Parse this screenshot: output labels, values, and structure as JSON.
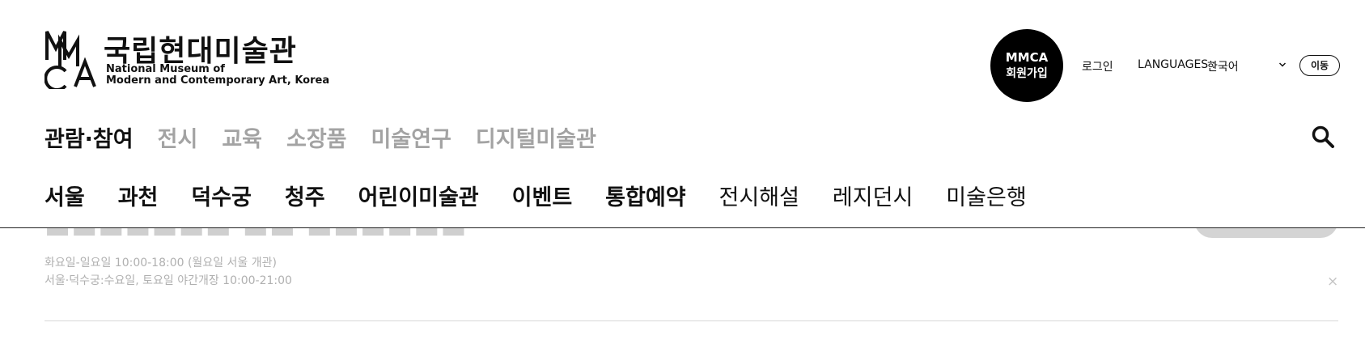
{
  "brand": {
    "name_kr": "국립현대미술관",
    "name_en_line1": "National Museum of",
    "name_en_line2": "Modern and Contemporary Art, Korea",
    "logo_icon": "mmca-logo-icon"
  },
  "utility": {
    "join_line1": "MMCA",
    "join_line2": "회원가입",
    "login": "로그인",
    "languages_label": "LANGUAGES :",
    "language_value": "한국어",
    "go_button": "이동"
  },
  "main_nav": [
    {
      "label": "관람·참여",
      "active": true
    },
    {
      "label": "전시",
      "active": false
    },
    {
      "label": "교육",
      "active": false
    },
    {
      "label": "소장품",
      "active": false
    },
    {
      "label": "미술연구",
      "active": false
    },
    {
      "label": "디지털미술관",
      "active": false
    }
  ],
  "sub_nav": [
    {
      "label": "서울",
      "bold": true
    },
    {
      "label": "과천",
      "bold": true
    },
    {
      "label": "덕수궁",
      "bold": true
    },
    {
      "label": "청주",
      "bold": true
    },
    {
      "label": "어린이미술관",
      "bold": true
    },
    {
      "label": "이벤트",
      "bold": true
    },
    {
      "label": "통합예약",
      "bold": true
    },
    {
      "label": "전시해설",
      "bold": false
    },
    {
      "label": "레지던시",
      "bold": false
    },
    {
      "label": "미술은행",
      "bold": false
    }
  ],
  "notice": {
    "hours_line1": "화요일-일요일 10:00-18:00 (월요일 서울 개관)",
    "hours_line2": "서울·덕수궁:수요일, 토요일 야간개장 10:00-21:00",
    "close_symbol": "×"
  },
  "icons": {
    "search": "search-icon",
    "chevron": "chevron-down-icon",
    "close": "close-icon"
  },
  "colors": {
    "text": "#111111",
    "inactive_nav": "#a3a3a3",
    "badge_bg": "#000000",
    "faded_text": "#b0b0b0"
  }
}
